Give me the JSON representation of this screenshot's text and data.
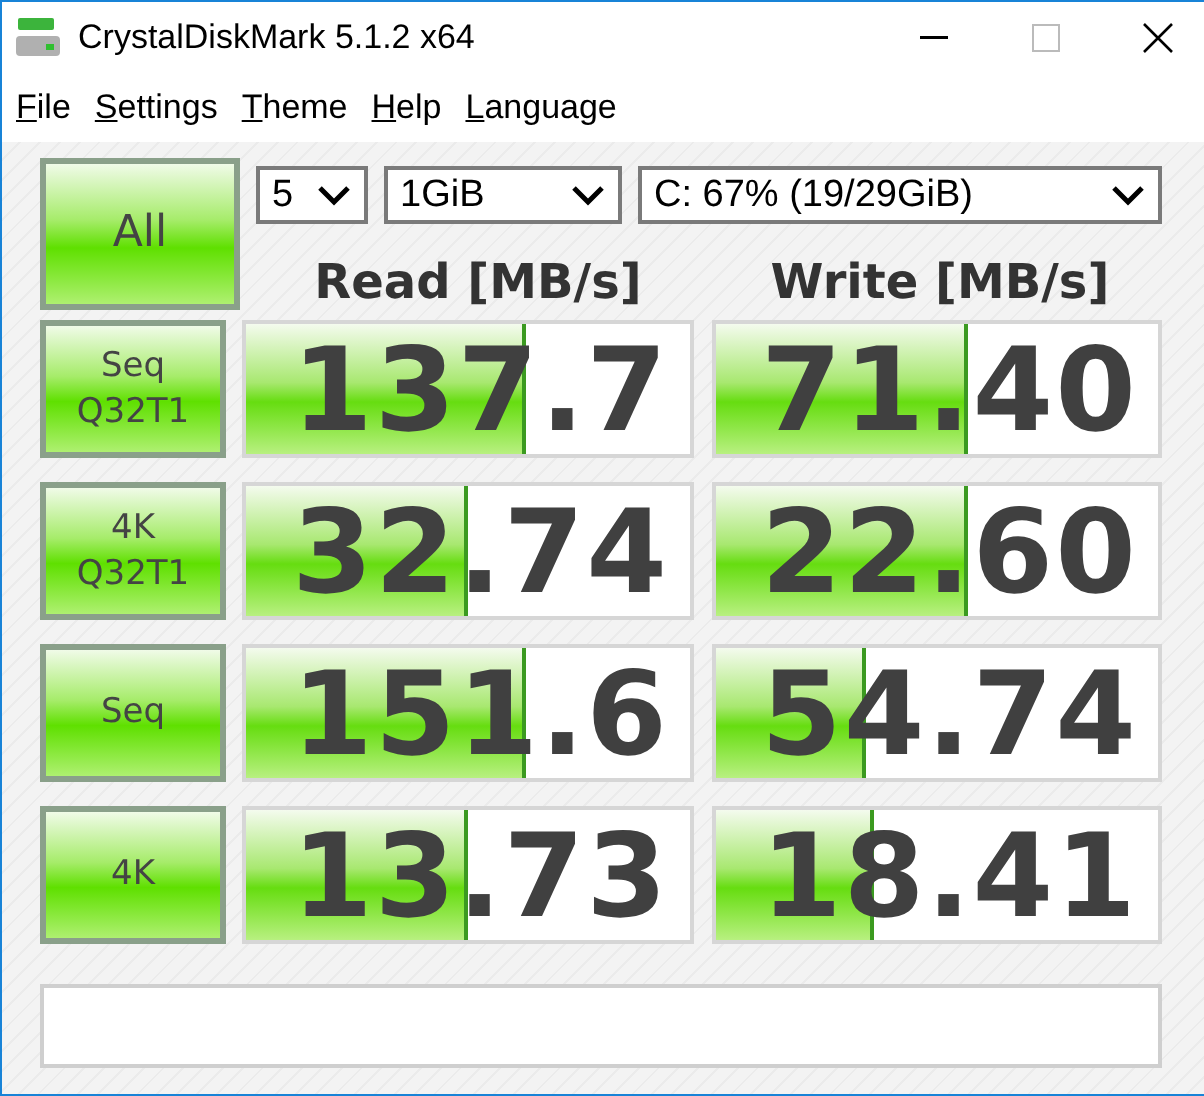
{
  "window": {
    "title": "CrystalDiskMark 5.1.2 x64"
  },
  "menu": [
    "File",
    "Settings",
    "Theme",
    "Help",
    "Language"
  ],
  "all_button": {
    "label": "All"
  },
  "selectors": {
    "count": "5",
    "size": "1GiB",
    "drive": "C: 67% (19/29GiB)"
  },
  "headers": {
    "read": "Read [MB/s]",
    "write": "Write [MB/s]"
  },
  "tests": [
    {
      "label": [
        "Seq",
        "Q32T1"
      ],
      "read": {
        "value": "137.7",
        "level": 0.63
      },
      "write": {
        "value": "71.40",
        "level": 0.57
      }
    },
    {
      "label": [
        "4K",
        "Q32T1"
      ],
      "read": {
        "value": "32.74",
        "level": 0.5
      },
      "write": {
        "value": "22.60",
        "level": 0.57
      }
    },
    {
      "label": [
        "Seq"
      ],
      "read": {
        "value": "151.6",
        "level": 0.63
      },
      "write": {
        "value": "54.74",
        "level": 0.34
      }
    },
    {
      "label": [
        "4K"
      ],
      "read": {
        "value": "13.73",
        "level": 0.5
      },
      "write": {
        "value": "18.41",
        "level": 0.36
      }
    }
  ]
}
